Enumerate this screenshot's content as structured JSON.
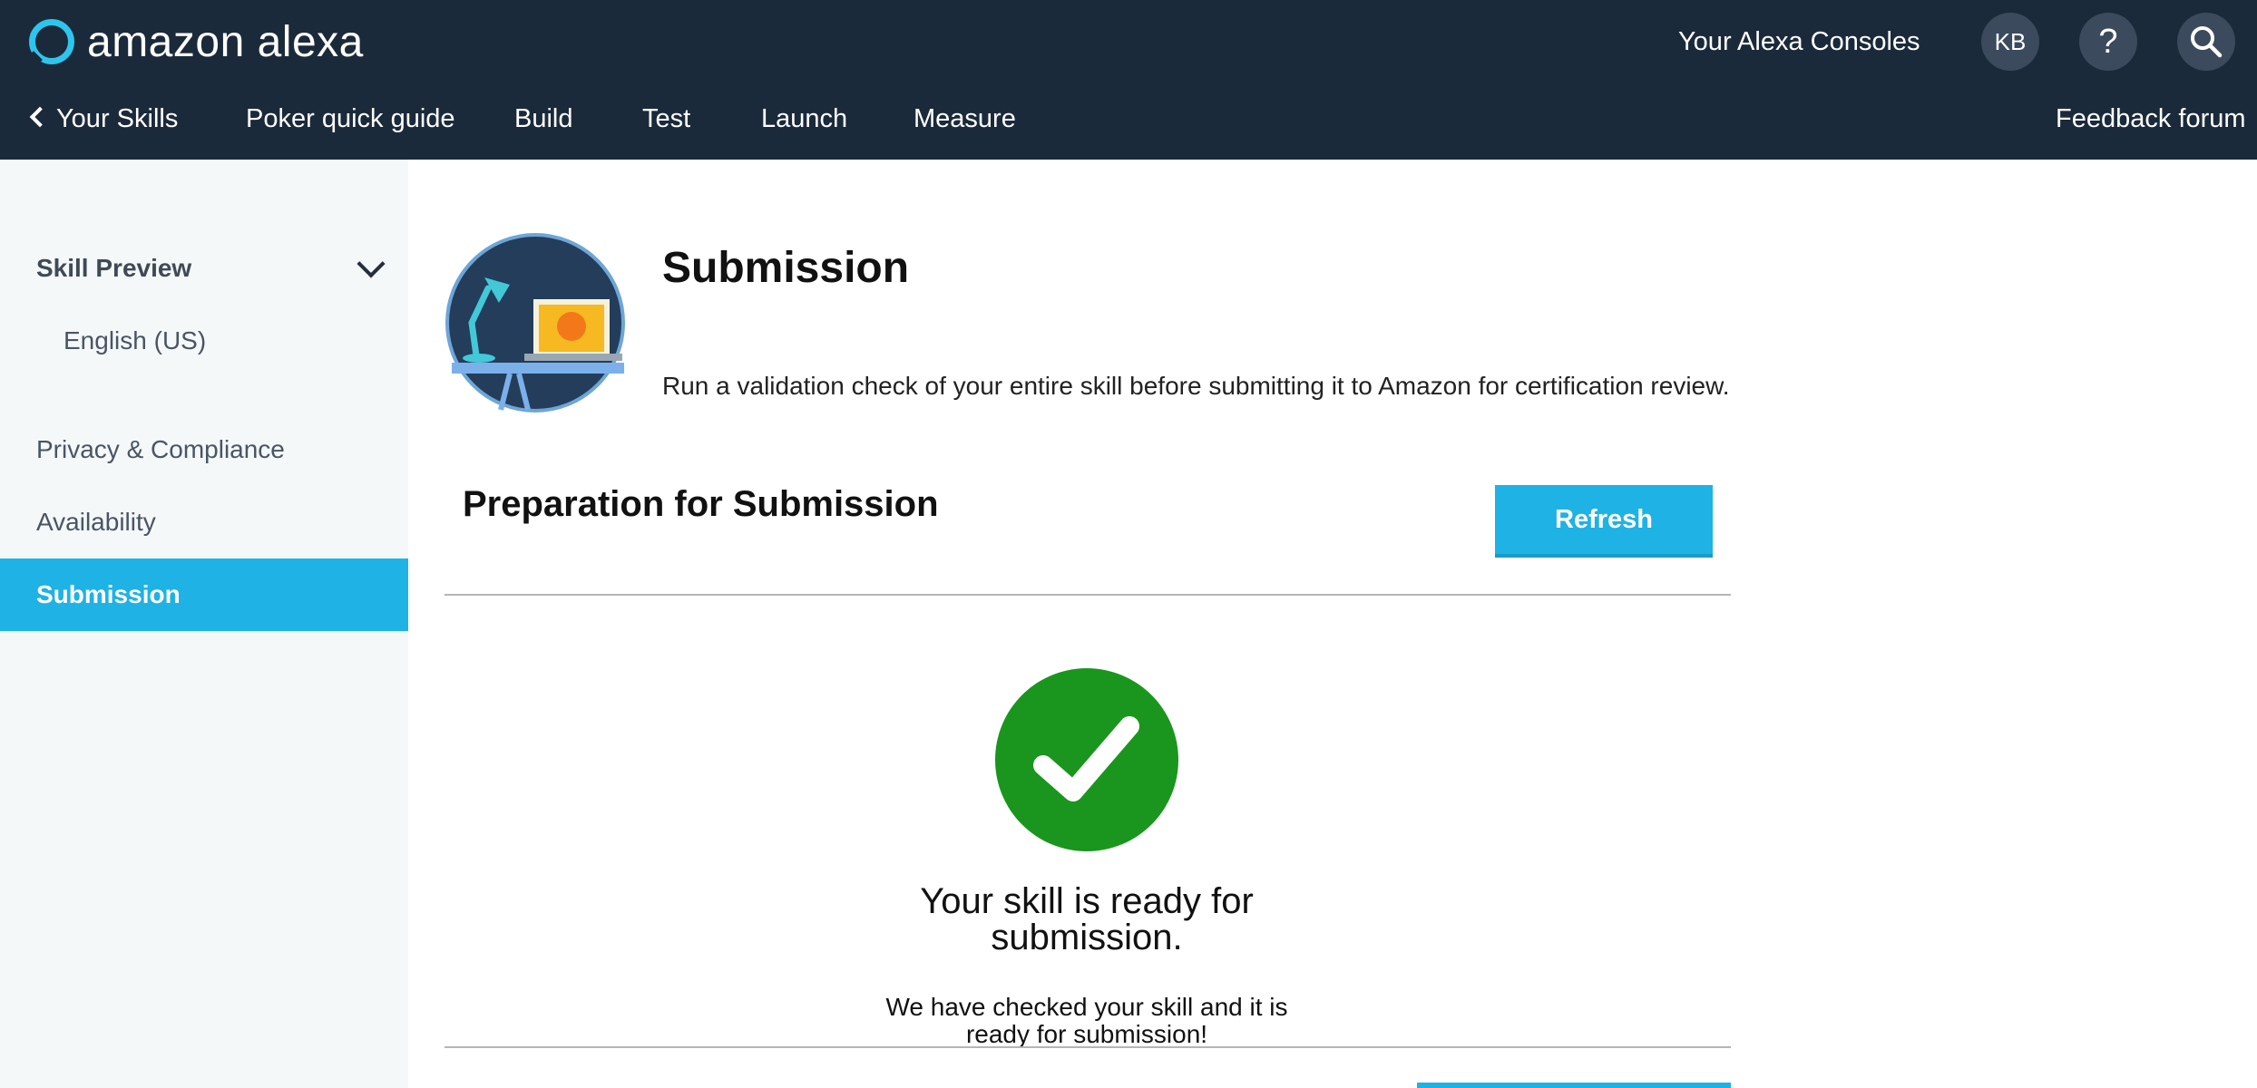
{
  "header": {
    "brand": "amazon alexa",
    "consoles_link": "Your Alexa Consoles",
    "avatar_initials": "KB",
    "help_label": "?",
    "search_icon": "search-icon",
    "colors": {
      "background": "#1b2a3a",
      "logo_accent": "#2ec5ec"
    }
  },
  "nav": {
    "back_label": "Your Skills",
    "skill_name": "Poker quick guide",
    "tabs": [
      {
        "label": "Build"
      },
      {
        "label": "Test"
      },
      {
        "label": "Launch",
        "active": true
      },
      {
        "label": "Measure"
      }
    ],
    "feedback_label": "Feedback forum"
  },
  "sidebar": {
    "sections": [
      {
        "label": "Skill Preview",
        "expanded": true
      },
      {
        "label": "English (US)"
      },
      {
        "label": "Privacy & Compliance"
      },
      {
        "label": "Availability"
      },
      {
        "label": "Submission",
        "active": true
      }
    ],
    "active_color": "#1fb2e5"
  },
  "main": {
    "title": "Submission",
    "description": "Run a validation check of your entire skill before submitting it to Amazon for certification review.",
    "preparation": {
      "heading": "Preparation for Submission",
      "refresh_label": "Refresh",
      "status_icon": "checkmark-icon",
      "status_color": "#1a961e",
      "status_title": "Your skill is ready for submission.",
      "status_message": "We have checked your skill and it is ready for submission!"
    }
  }
}
